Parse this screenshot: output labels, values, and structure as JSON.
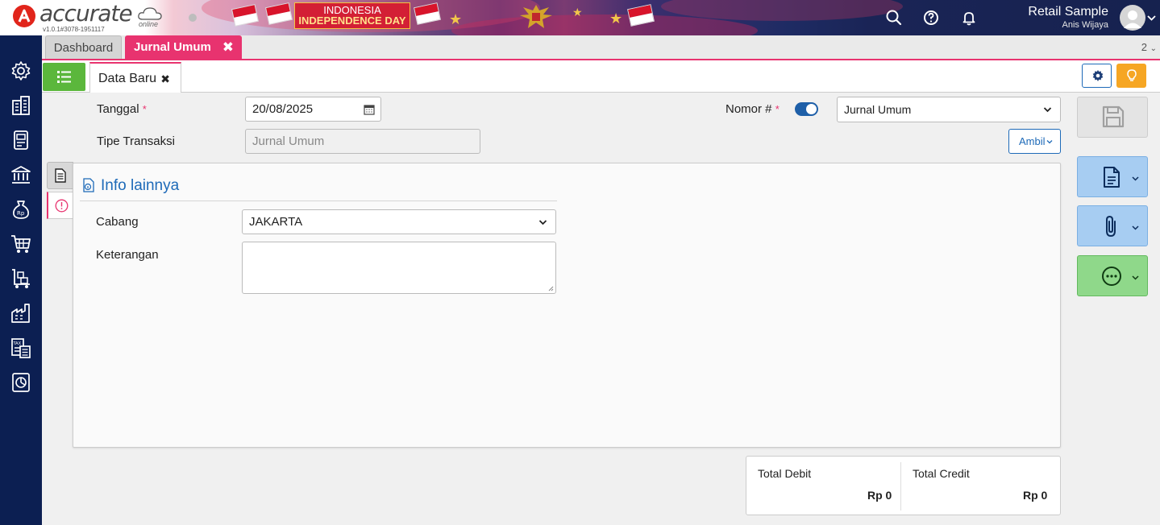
{
  "brand": {
    "name": "accurate",
    "sub": "online",
    "version": "v1.0.1#3078-1951117",
    "accent": "#e1251b"
  },
  "header": {
    "banner_line1": "INDONESIA",
    "banner_line2": "INDEPENDENCE DAY",
    "user_name": "Retail Sample",
    "user_sub": "Anis Wijaya",
    "icons": [
      "search-icon",
      "help-icon",
      "bell-icon",
      "avatar",
      "chevron-down-icon"
    ]
  },
  "sidebar": {
    "items": [
      {
        "icon": "gear-icon"
      },
      {
        "icon": "company-icon"
      },
      {
        "icon": "ledger-icon"
      },
      {
        "icon": "bank-icon"
      },
      {
        "icon": "money-bag-icon"
      },
      {
        "icon": "cart-icon"
      },
      {
        "icon": "inventory-cart-icon"
      },
      {
        "icon": "factory-icon"
      },
      {
        "icon": "tax-icon"
      },
      {
        "icon": "report-chart-icon"
      }
    ],
    "color": "#0c1f52"
  },
  "tabs": {
    "items": [
      {
        "label": "Dashboard"
      },
      {
        "label": "Jurnal Umum",
        "close": "✖"
      }
    ],
    "count": "2",
    "accent": "#e8336f"
  },
  "subheader": {
    "tab_label": "Data Baru",
    "tab_close": "✖"
  },
  "form": {
    "tanggal_label": "Tanggal",
    "tanggal_value": "20/08/2025",
    "tipe_label": "Tipe Transaksi",
    "tipe_value": "Jurnal Umum",
    "nomor_label": "Nomor #",
    "nomor_toggle": true,
    "nomor_select": "Jurnal Umum",
    "required_mark": "*",
    "ambil_label": "Ambil"
  },
  "info": {
    "title": "Info lainnya",
    "cabang_label": "Cabang",
    "cabang_value": "JAKARTA",
    "keterangan_label": "Keterangan",
    "keterangan_value": ""
  },
  "totals": {
    "debit_label": "Total Debit",
    "debit_value": "Rp 0",
    "credit_label": "Total Credit",
    "credit_value": "Rp 0"
  }
}
